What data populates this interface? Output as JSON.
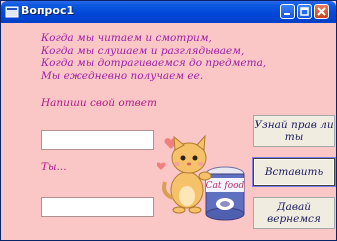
{
  "window": {
    "title": "Вопрос1"
  },
  "poem": [
    "Когда мы читаем и смотрим,",
    "Когда мы слушаем и  разглядываем,",
    "Когда мы дотрагиваемся до предмета,",
    "Мы ежедневно получаем ее."
  ],
  "prompt": "Напиши свой ответ",
  "answer_field": {
    "value": ""
  },
  "you_label": "Ты...",
  "result_field": {
    "value": ""
  },
  "buttons": {
    "check": "Узнай прав ли ты",
    "insert": "Вставить",
    "back": "Давай вернемся"
  },
  "illustration": {
    "can_label": "Cat food"
  },
  "colors": {
    "background": "#fbc6c6",
    "text": "#a020a8",
    "titlebar": "#0046d8"
  }
}
